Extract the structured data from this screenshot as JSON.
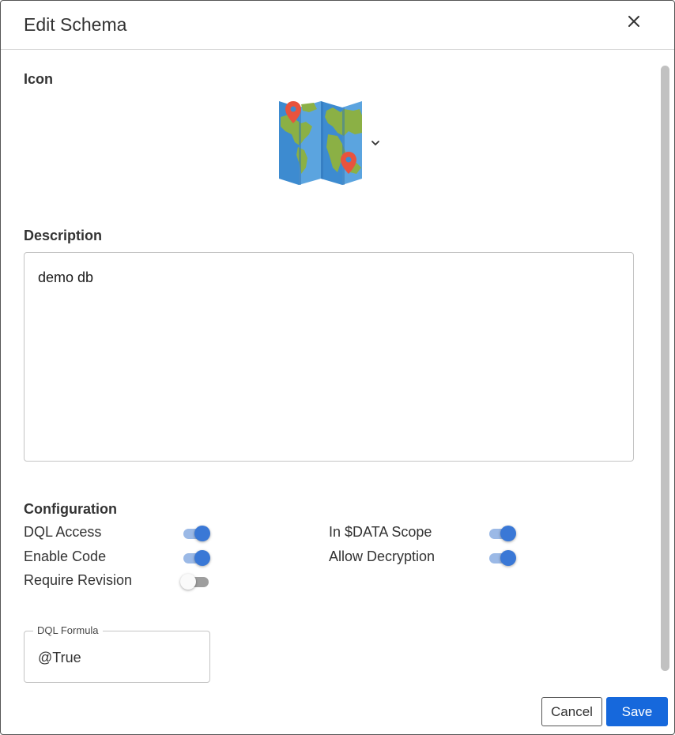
{
  "dialog": {
    "title": "Edit Schema"
  },
  "icon_section": {
    "label": "Icon",
    "selected_icon": "folded-map-icon"
  },
  "description": {
    "label": "Description",
    "value": "demo db"
  },
  "configuration": {
    "label": "Configuration",
    "options": [
      {
        "label": "DQL Access",
        "enabled": true
      },
      {
        "label": "Enable Code",
        "enabled": true
      },
      {
        "label": "Require Revision",
        "enabled": false
      },
      {
        "label": "In $DATA Scope",
        "enabled": true
      },
      {
        "label": "Allow Decryption",
        "enabled": true
      }
    ]
  },
  "dql_formula": {
    "label": "DQL Formula",
    "value": "@True"
  },
  "actions": {
    "cancel_label": "Cancel",
    "save_label": "Save"
  },
  "colors": {
    "accent": "#1668dc",
    "toggle_on": "#3a78d6"
  }
}
